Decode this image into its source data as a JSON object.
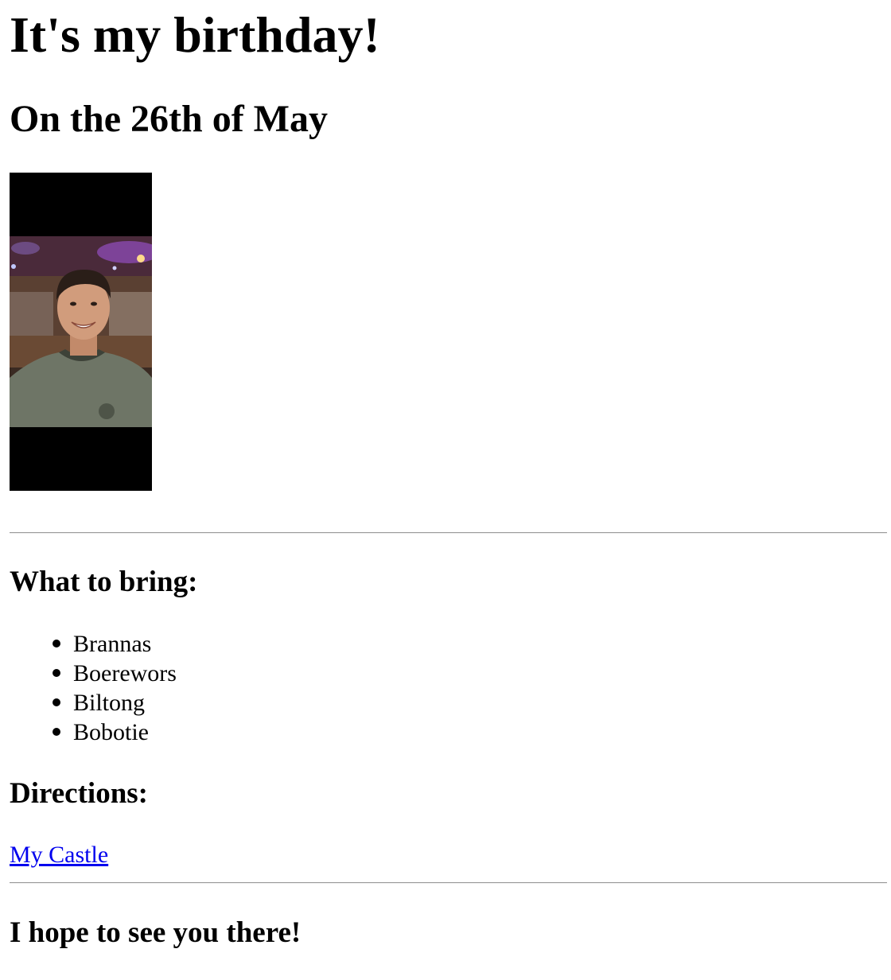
{
  "page": {
    "title": "It's my birthday!",
    "date_line": "On the 26th of May",
    "photo": "portrait photo of a smiling man in a restaurant"
  },
  "bring": {
    "heading": "What to bring:",
    "items": [
      "Brannas",
      "Boerewors",
      "Biltong",
      "Bobotie"
    ]
  },
  "directions": {
    "heading": "Directions:",
    "link_text": "My Castle"
  },
  "closing": {
    "text": "I hope to see you there!"
  },
  "colors": {
    "link": "#0000ee",
    "rule": "#9a9a9a",
    "photo_background": "#000000"
  }
}
